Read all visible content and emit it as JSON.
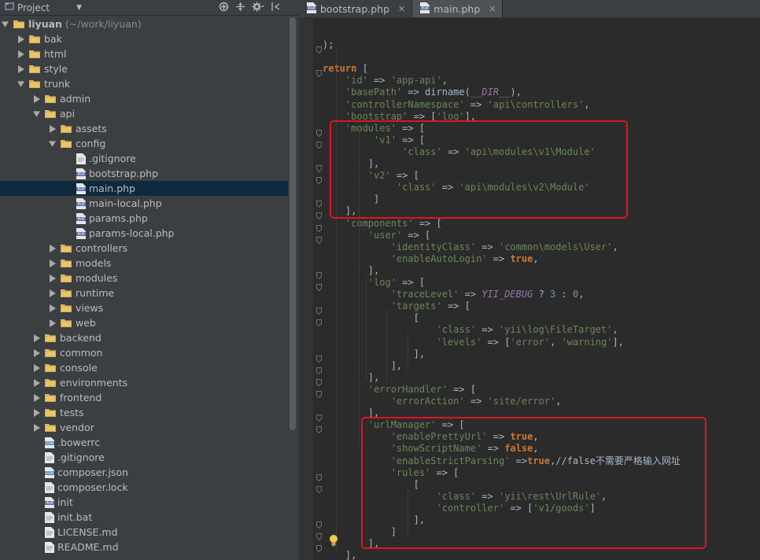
{
  "panel": {
    "title": "Project",
    "tree": [
      {
        "label": "liyuan",
        "suffix": "(~/work/liyuan)",
        "depth": 0,
        "kind": "folder",
        "arrow": "down",
        "selected": false
      },
      {
        "label": "bak",
        "depth": 1,
        "kind": "folder",
        "arrow": "right",
        "selected": false
      },
      {
        "label": "html",
        "depth": 1,
        "kind": "folder",
        "arrow": "right",
        "selected": false
      },
      {
        "label": "style",
        "depth": 1,
        "kind": "folder",
        "arrow": "right",
        "selected": false
      },
      {
        "label": "trunk",
        "depth": 1,
        "kind": "folder",
        "arrow": "down",
        "selected": false
      },
      {
        "label": "admin",
        "depth": 2,
        "kind": "folder",
        "arrow": "right",
        "selected": false
      },
      {
        "label": "api",
        "depth": 2,
        "kind": "folder",
        "arrow": "down",
        "selected": false
      },
      {
        "label": "assets",
        "depth": 3,
        "kind": "folder",
        "arrow": "right",
        "selected": false
      },
      {
        "label": "config",
        "depth": 3,
        "kind": "folder",
        "arrow": "down",
        "selected": false
      },
      {
        "label": ".gitignore",
        "depth": 4,
        "kind": "text",
        "arrow": "none",
        "selected": false
      },
      {
        "label": "bootstrap.php",
        "depth": 4,
        "kind": "php",
        "arrow": "none",
        "selected": false
      },
      {
        "label": "main.php",
        "depth": 4,
        "kind": "php",
        "arrow": "none",
        "selected": true
      },
      {
        "label": "main-local.php",
        "depth": 4,
        "kind": "php",
        "arrow": "none",
        "selected": false
      },
      {
        "label": "params.php",
        "depth": 4,
        "kind": "php",
        "arrow": "none",
        "selected": false
      },
      {
        "label": "params-local.php",
        "depth": 4,
        "kind": "php",
        "arrow": "none",
        "selected": false
      },
      {
        "label": "controllers",
        "depth": 3,
        "kind": "folder",
        "arrow": "right",
        "selected": false
      },
      {
        "label": "models",
        "depth": 3,
        "kind": "folder",
        "arrow": "right",
        "selected": false
      },
      {
        "label": "modules",
        "depth": 3,
        "kind": "folder",
        "arrow": "right",
        "selected": false
      },
      {
        "label": "runtime",
        "depth": 3,
        "kind": "folder",
        "arrow": "right",
        "selected": false
      },
      {
        "label": "views",
        "depth": 3,
        "kind": "folder",
        "arrow": "right",
        "selected": false
      },
      {
        "label": "web",
        "depth": 3,
        "kind": "folder",
        "arrow": "right",
        "selected": false
      },
      {
        "label": "backend",
        "depth": 2,
        "kind": "folder",
        "arrow": "right",
        "selected": false
      },
      {
        "label": "common",
        "depth": 2,
        "kind": "folder",
        "arrow": "right",
        "selected": false
      },
      {
        "label": "console",
        "depth": 2,
        "kind": "folder",
        "arrow": "right",
        "selected": false
      },
      {
        "label": "environments",
        "depth": 2,
        "kind": "folder",
        "arrow": "right",
        "selected": false
      },
      {
        "label": "frontend",
        "depth": 2,
        "kind": "folder",
        "arrow": "right",
        "selected": false
      },
      {
        "label": "tests",
        "depth": 2,
        "kind": "folder",
        "arrow": "right",
        "selected": false
      },
      {
        "label": "vendor",
        "depth": 2,
        "kind": "folder",
        "arrow": "right",
        "selected": false
      },
      {
        "label": ".bowerrc",
        "depth": 2,
        "kind": "json",
        "arrow": "none",
        "selected": false
      },
      {
        "label": ".gitignore",
        "depth": 2,
        "kind": "text",
        "arrow": "none",
        "selected": false
      },
      {
        "label": "composer.json",
        "depth": 2,
        "kind": "json",
        "arrow": "none",
        "selected": false
      },
      {
        "label": "composer.lock",
        "depth": 2,
        "kind": "text",
        "arrow": "none",
        "selected": false
      },
      {
        "label": "init",
        "depth": 2,
        "kind": "php",
        "arrow": "none",
        "selected": false
      },
      {
        "label": "init.bat",
        "depth": 2,
        "kind": "text",
        "arrow": "none",
        "selected": false
      },
      {
        "label": "LICENSE.md",
        "depth": 2,
        "kind": "text",
        "arrow": "none",
        "selected": false
      },
      {
        "label": "README.md",
        "depth": 2,
        "kind": "text",
        "arrow": "none",
        "selected": false
      }
    ]
  },
  "editor": {
    "tabs": [
      {
        "label": "bootstrap.php",
        "active": false
      },
      {
        "label": "main.php",
        "active": true
      }
    ],
    "lines": [
      {
        "tokens": [
          {
            "t": "op",
            "v": ");"
          }
        ]
      },
      {
        "tokens": []
      },
      {
        "tokens": [
          {
            "t": "kw",
            "v": "return"
          },
          {
            "t": "op",
            "v": " ["
          }
        ]
      },
      {
        "tokens": [
          {
            "t": "op",
            "v": "    "
          },
          {
            "t": "str",
            "v": "'id'"
          },
          {
            "t": "op",
            "v": " => "
          },
          {
            "t": "str",
            "v": "'app-api'"
          },
          {
            "t": "op",
            "v": ","
          }
        ]
      },
      {
        "tokens": [
          {
            "t": "op",
            "v": "    "
          },
          {
            "t": "str",
            "v": "'basePath'"
          },
          {
            "t": "op",
            "v": " => dirname("
          },
          {
            "t": "con",
            "v": "__DIR__"
          },
          {
            "t": "op",
            "v": "),"
          }
        ]
      },
      {
        "tokens": [
          {
            "t": "op",
            "v": "    "
          },
          {
            "t": "str",
            "v": "'controllerNamespace'"
          },
          {
            "t": "op",
            "v": " => "
          },
          {
            "t": "str",
            "v": "'api\\controllers'"
          },
          {
            "t": "op",
            "v": ","
          }
        ]
      },
      {
        "tokens": [
          {
            "t": "op",
            "v": "    "
          },
          {
            "t": "str",
            "v": "'bootstrap'"
          },
          {
            "t": "op",
            "v": " => ["
          },
          {
            "t": "str",
            "v": "'log'"
          },
          {
            "t": "op",
            "v": "],"
          }
        ]
      },
      {
        "tokens": [
          {
            "t": "op",
            "v": "    "
          },
          {
            "t": "str",
            "v": "'modules'"
          },
          {
            "t": "op",
            "v": " => ["
          }
        ]
      },
      {
        "tokens": [
          {
            "t": "op",
            "v": "         "
          },
          {
            "t": "str",
            "v": "'v1'"
          },
          {
            "t": "op",
            "v": " => ["
          }
        ]
      },
      {
        "tokens": [
          {
            "t": "op",
            "v": "              "
          },
          {
            "t": "str",
            "v": "'class'"
          },
          {
            "t": "op",
            "v": " => "
          },
          {
            "t": "str",
            "v": "'api\\modules\\v1\\Module'"
          }
        ]
      },
      {
        "tokens": [
          {
            "t": "op",
            "v": "        ],"
          }
        ]
      },
      {
        "tokens": [
          {
            "t": "op",
            "v": "        "
          },
          {
            "t": "str",
            "v": "'v2'"
          },
          {
            "t": "op",
            "v": " => ["
          }
        ]
      },
      {
        "tokens": [
          {
            "t": "op",
            "v": "             "
          },
          {
            "t": "str",
            "v": "'class'"
          },
          {
            "t": "op",
            "v": " => "
          },
          {
            "t": "str",
            "v": "'api\\modules\\v2\\Module'"
          }
        ]
      },
      {
        "tokens": [
          {
            "t": "op",
            "v": "         ]"
          }
        ]
      },
      {
        "tokens": [
          {
            "t": "op",
            "v": "    ],"
          }
        ]
      },
      {
        "tokens": [
          {
            "t": "op",
            "v": "    "
          },
          {
            "t": "str",
            "v": "'components'"
          },
          {
            "t": "op",
            "v": " => ["
          }
        ]
      },
      {
        "tokens": [
          {
            "t": "op",
            "v": "        "
          },
          {
            "t": "str",
            "v": "'user'"
          },
          {
            "t": "op",
            "v": " => ["
          }
        ]
      },
      {
        "tokens": [
          {
            "t": "op",
            "v": "            "
          },
          {
            "t": "str",
            "v": "'identityClass'"
          },
          {
            "t": "op",
            "v": " => "
          },
          {
            "t": "str",
            "v": "'common\\models\\User'"
          },
          {
            "t": "op",
            "v": ","
          }
        ]
      },
      {
        "tokens": [
          {
            "t": "op",
            "v": "            "
          },
          {
            "t": "str",
            "v": "'enableAutoLogin'"
          },
          {
            "t": "op",
            "v": " => "
          },
          {
            "t": "kw",
            "v": "true"
          },
          {
            "t": "op",
            "v": ","
          }
        ]
      },
      {
        "tokens": [
          {
            "t": "op",
            "v": "        ],"
          }
        ]
      },
      {
        "tokens": [
          {
            "t": "op",
            "v": "        "
          },
          {
            "t": "str",
            "v": "'log'"
          },
          {
            "t": "op",
            "v": " => ["
          }
        ]
      },
      {
        "tokens": [
          {
            "t": "op",
            "v": "            "
          },
          {
            "t": "str",
            "v": "'traceLevel'"
          },
          {
            "t": "op",
            "v": " => "
          },
          {
            "t": "con",
            "v": "YII_DEBUG"
          },
          {
            "t": "op",
            "v": " ? "
          },
          {
            "t": "num",
            "v": "3"
          },
          {
            "t": "op",
            "v": " : "
          },
          {
            "t": "num",
            "v": "0"
          },
          {
            "t": "op",
            "v": ","
          }
        ]
      },
      {
        "tokens": [
          {
            "t": "op",
            "v": "            "
          },
          {
            "t": "str",
            "v": "'targets'"
          },
          {
            "t": "op",
            "v": " => ["
          }
        ]
      },
      {
        "tokens": [
          {
            "t": "op",
            "v": "                ["
          }
        ]
      },
      {
        "tokens": [
          {
            "t": "op",
            "v": "                    "
          },
          {
            "t": "str",
            "v": "'class'"
          },
          {
            "t": "op",
            "v": " => "
          },
          {
            "t": "str",
            "v": "'yii\\log\\FileTarget'"
          },
          {
            "t": "op",
            "v": ","
          }
        ]
      },
      {
        "tokens": [
          {
            "t": "op",
            "v": "                    "
          },
          {
            "t": "str",
            "v": "'levels'"
          },
          {
            "t": "op",
            "v": " => ["
          },
          {
            "t": "str",
            "v": "'error'"
          },
          {
            "t": "op",
            "v": ", "
          },
          {
            "t": "str",
            "v": "'warning'"
          },
          {
            "t": "op",
            "v": "],"
          }
        ]
      },
      {
        "tokens": [
          {
            "t": "op",
            "v": "                ],"
          }
        ]
      },
      {
        "tokens": [
          {
            "t": "op",
            "v": "            ],"
          }
        ]
      },
      {
        "tokens": [
          {
            "t": "op",
            "v": "        ],"
          }
        ]
      },
      {
        "tokens": [
          {
            "t": "op",
            "v": "        "
          },
          {
            "t": "str",
            "v": "'errorHandler'"
          },
          {
            "t": "op",
            "v": " => ["
          }
        ]
      },
      {
        "tokens": [
          {
            "t": "op",
            "v": "            "
          },
          {
            "t": "str",
            "v": "'errorAction'"
          },
          {
            "t": "op",
            "v": " => "
          },
          {
            "t": "str",
            "v": "'site/error'"
          },
          {
            "t": "op",
            "v": ","
          }
        ]
      },
      {
        "tokens": [
          {
            "t": "op",
            "v": "        ],"
          }
        ]
      },
      {
        "tokens": [
          {
            "t": "op",
            "v": "        "
          },
          {
            "t": "str",
            "v": "'urlManager'"
          },
          {
            "t": "op",
            "v": " => ["
          }
        ]
      },
      {
        "tokens": [
          {
            "t": "op",
            "v": "            "
          },
          {
            "t": "str",
            "v": "'enablePrettyUrl'"
          },
          {
            "t": "op",
            "v": " => "
          },
          {
            "t": "kw",
            "v": "true"
          },
          {
            "t": "op",
            "v": ","
          }
        ]
      },
      {
        "tokens": [
          {
            "t": "op",
            "v": "            "
          },
          {
            "t": "str",
            "v": "'showScriptName'"
          },
          {
            "t": "op",
            "v": " => "
          },
          {
            "t": "kw",
            "v": "false"
          },
          {
            "t": "op",
            "v": ","
          }
        ]
      },
      {
        "tokens": [
          {
            "t": "op",
            "v": "            "
          },
          {
            "t": "str",
            "v": "'enableStrictParsing'"
          },
          {
            "t": "op",
            "v": " =>"
          },
          {
            "t": "kw",
            "v": "true"
          },
          {
            "t": "op",
            "v": ",//false不需要严格输入网址"
          }
        ]
      },
      {
        "tokens": [
          {
            "t": "op",
            "v": "            "
          },
          {
            "t": "str",
            "v": "'rules'"
          },
          {
            "t": "op",
            "v": " => ["
          }
        ]
      },
      {
        "tokens": [
          {
            "t": "op",
            "v": "                ["
          }
        ]
      },
      {
        "tokens": [
          {
            "t": "op",
            "v": "                    "
          },
          {
            "t": "str",
            "v": "'class'"
          },
          {
            "t": "op",
            "v": " => "
          },
          {
            "t": "str",
            "v": "'yii\\rest\\UrlRule'"
          },
          {
            "t": "op",
            "v": ","
          }
        ]
      },
      {
        "tokens": [
          {
            "t": "op",
            "v": "                    "
          },
          {
            "t": "str",
            "v": "'controller'"
          },
          {
            "t": "op",
            "v": " => ["
          },
          {
            "t": "str",
            "v": "'v1/goods'"
          },
          {
            "t": "op",
            "v": "]"
          }
        ]
      },
      {
        "tokens": [
          {
            "t": "op",
            "v": "                ],"
          }
        ]
      },
      {
        "tokens": [
          {
            "t": "op",
            "v": "            ]"
          }
        ]
      },
      {
        "tokens": [
          {
            "t": "op",
            "v": "        ],"
          }
        ]
      },
      {
        "tokens": [
          {
            "t": "op",
            "v": "    ],"
          }
        ]
      }
    ]
  },
  "colors": {
    "panel_bg": "#3c3f41",
    "editor_bg": "#2b2b2b",
    "selection": "#0d293e",
    "highlight_box": "#e0141e",
    "string": "#6a8759",
    "keyword": "#cc7832",
    "constant": "#9876aa",
    "number": "#6897bb"
  }
}
